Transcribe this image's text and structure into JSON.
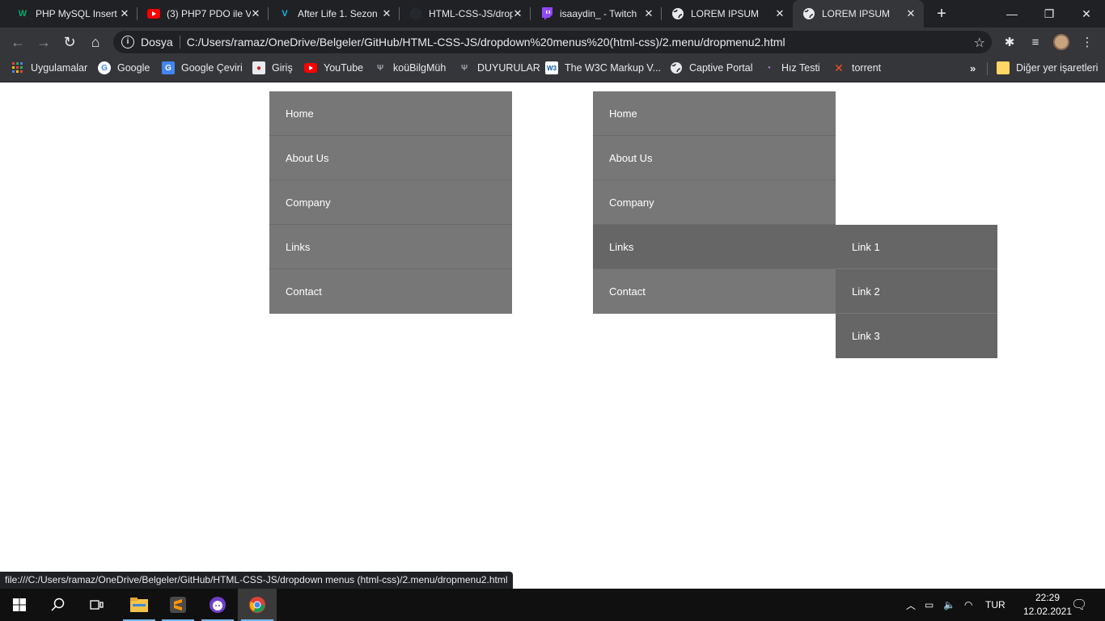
{
  "browser": {
    "tabs": [
      {
        "title": "PHP MySQL Insert",
        "favicon": "w3schools-icon",
        "active": false
      },
      {
        "title": "(3) PHP7 PDO ile V",
        "favicon": "youtube-icon",
        "active": false
      },
      {
        "title": "After Life 1. Sezon",
        "favicon": "vimeo-icon",
        "active": false
      },
      {
        "title": "HTML-CSS-JS/drop",
        "favicon": "github-icon",
        "active": false
      },
      {
        "title": "isaaydin_ - Twitch",
        "favicon": "twitch-icon",
        "active": false
      },
      {
        "title": "LOREM IPSUM",
        "favicon": "globe-icon",
        "active": false
      },
      {
        "title": "LOREM IPSUM",
        "favicon": "globe-icon",
        "active": true
      }
    ],
    "address": {
      "scheme_label": "Dosya",
      "url": "C:/Users/ramaz/OneDrive/Belgeler/GitHub/HTML-CSS-JS/dropdown%20menus%20(html-css)/2.menu/dropmenu2.html"
    },
    "bookmarks": [
      {
        "label": "Uygulamalar",
        "icon": "apps-grid-icon"
      },
      {
        "label": "Google",
        "icon": "google-icon"
      },
      {
        "label": "Google Çeviri",
        "icon": "google-translate-icon"
      },
      {
        "label": "Giriş",
        "icon": "login-icon"
      },
      {
        "label": "YouTube",
        "icon": "youtube-icon"
      },
      {
        "label": "koüBilgMüh",
        "icon": "kou-icon"
      },
      {
        "label": "DUYURULAR",
        "icon": "kou-icon"
      },
      {
        "label": "The W3C Markup V...",
        "icon": "w3c-icon"
      },
      {
        "label": "Captive Portal",
        "icon": "globe-icon"
      },
      {
        "label": "Hız Testi",
        "icon": "speedtest-icon"
      },
      {
        "label": "torrent",
        "icon": "torrent-icon"
      }
    ],
    "other_bookmarks": "Diğer yer işaretleri",
    "status_url": "file:///C:/Users/ramaz/OneDrive/Belgeler/GitHub/HTML-CSS-JS/dropdown menus (html-css)/2.menu/dropmenu2.html"
  },
  "page": {
    "menu_left": [
      "Home",
      "About Us",
      "Company",
      "Links",
      "Contact"
    ],
    "menu_right": [
      "Home",
      "About Us",
      "Company",
      "Links",
      "Contact"
    ],
    "submenu": [
      "Link 1",
      "Link 2",
      "Link 3"
    ],
    "colors": {
      "menu_bg": "#777777",
      "menu_hover_bg": "#666666",
      "text": "#ffffff"
    }
  },
  "taskbar": {
    "apps": [
      "start-icon",
      "search-icon",
      "task-view-icon",
      "file-explorer-icon",
      "sublime-text-icon",
      "github-desktop-icon",
      "chrome-icon"
    ],
    "language": "TUR",
    "time": "22:29",
    "date": "12.02.2021"
  }
}
